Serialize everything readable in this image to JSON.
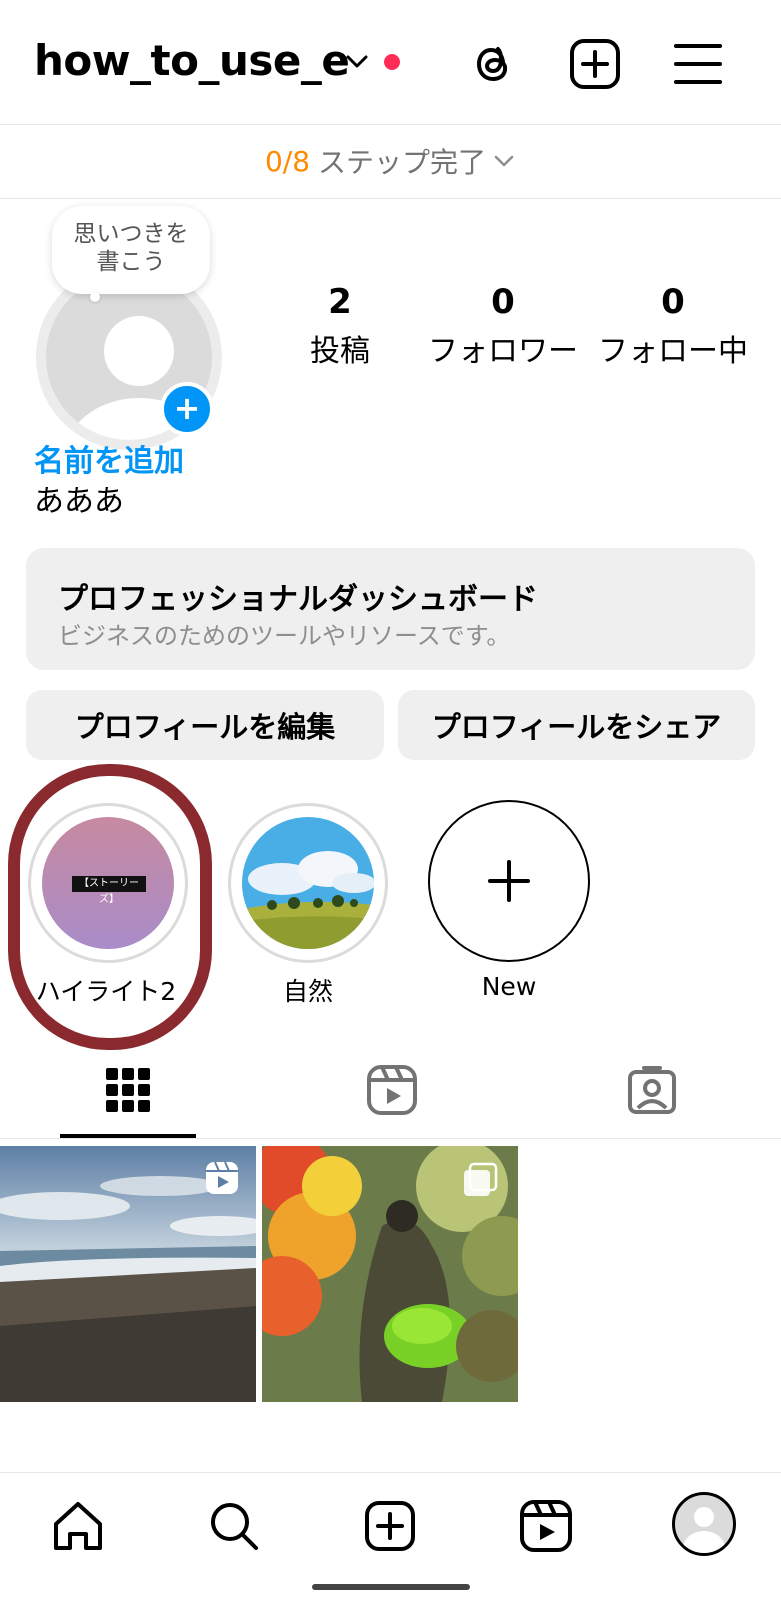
{
  "header": {
    "username": "how_to_use_e"
  },
  "steps": {
    "count": "0/8",
    "label": "ステップ完了"
  },
  "profile": {
    "note_bubble": "思いつきを\n書こう",
    "stats": [
      {
        "value": "2",
        "label": "投稿"
      },
      {
        "value": "0",
        "label": "フォロワー"
      },
      {
        "value": "0",
        "label": "フォロー中"
      }
    ],
    "add_name": "名前を追加",
    "bio": "あああ"
  },
  "pro_dashboard": {
    "title": "プロフェッショナルダッシュボード",
    "subtitle": "ビジネスのためのツールやリソースです。"
  },
  "buttons": {
    "edit": "プロフィールを編集",
    "share": "プロフィールをシェア"
  },
  "highlights": [
    {
      "label": "ハイライト2",
      "chip": "【ストーリーズ】"
    },
    {
      "label": "自然"
    },
    {
      "label": "New"
    }
  ],
  "colors": {
    "accent": "#0095f6",
    "steps_count": "#ff8a00",
    "notification": "#ff2d55",
    "annotation_outline": "#8b2a2e"
  }
}
